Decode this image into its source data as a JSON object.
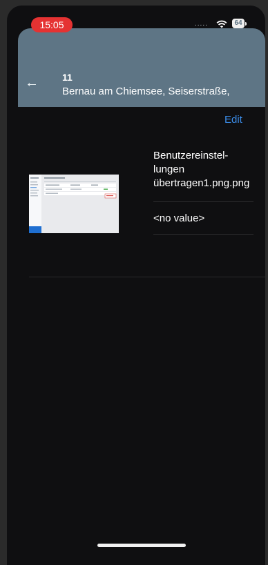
{
  "status_bar": {
    "time": "15:05",
    "signal": ".....",
    "battery": "64"
  },
  "header": {
    "number": "11",
    "address": "Bernau am Chiemsee, Seiserstraße,"
  },
  "toolbar": {
    "edit_label": "Edit"
  },
  "attachment": {
    "file_name": "Benutzereinstel-lungen übertragen1.png.png",
    "value": "<no value>"
  },
  "colors": {
    "header_bg": "#5e7585",
    "accent": "#3b8ce8",
    "time_pill": "#e53232"
  }
}
